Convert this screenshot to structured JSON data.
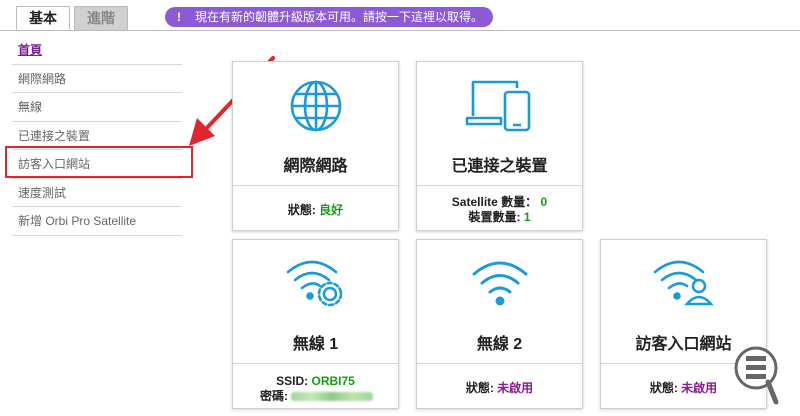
{
  "tabs": [
    {
      "label": "基本",
      "active": true
    },
    {
      "label": "進階",
      "active": false
    }
  ],
  "banner": {
    "icon": "!",
    "text": "現在有新的韌體升級版本可用。請按一下這裡以取得。",
    "color": "#8d5ad5"
  },
  "sidebar": {
    "items": [
      {
        "label": "首頁",
        "current": true
      },
      {
        "label": "網際網路"
      },
      {
        "label": "無線"
      },
      {
        "label": "已連接之裝置"
      },
      {
        "label": "訪客入口網站",
        "highlighted": true
      },
      {
        "label": "速度測試"
      },
      {
        "label": "新增 Orbi Pro Satellite"
      }
    ]
  },
  "cards": {
    "internet": {
      "title": "網際網路",
      "status_label": "狀態:",
      "status_value": "良好",
      "icon": "globe-icon"
    },
    "devices": {
      "title": "已連接之裝置",
      "satellite_label": "Satellite 數量：",
      "satellite_value": "0",
      "devices_label": "裝置數量:",
      "devices_value": "1",
      "icon": "laptop-phone-icon"
    },
    "wireless1": {
      "title": "無線 1",
      "ssid_label": "SSID:",
      "ssid_value": "ORBI75",
      "password_label": "密碼:",
      "icon": "wifi-settings-icon"
    },
    "wireless2": {
      "title": "無線 2",
      "status_label": "狀態:",
      "status_value": "未啟用",
      "icon": "wifi-icon"
    },
    "guest": {
      "title": "訪客入口網站",
      "status_label": "狀態:",
      "status_value": "未啟用",
      "icon": "wifi-user-icon"
    }
  },
  "colors": {
    "accent": "#1a9bd7",
    "good": "#12a012",
    "inactive": "#8a1c8a",
    "highlight": "#e0262a"
  }
}
